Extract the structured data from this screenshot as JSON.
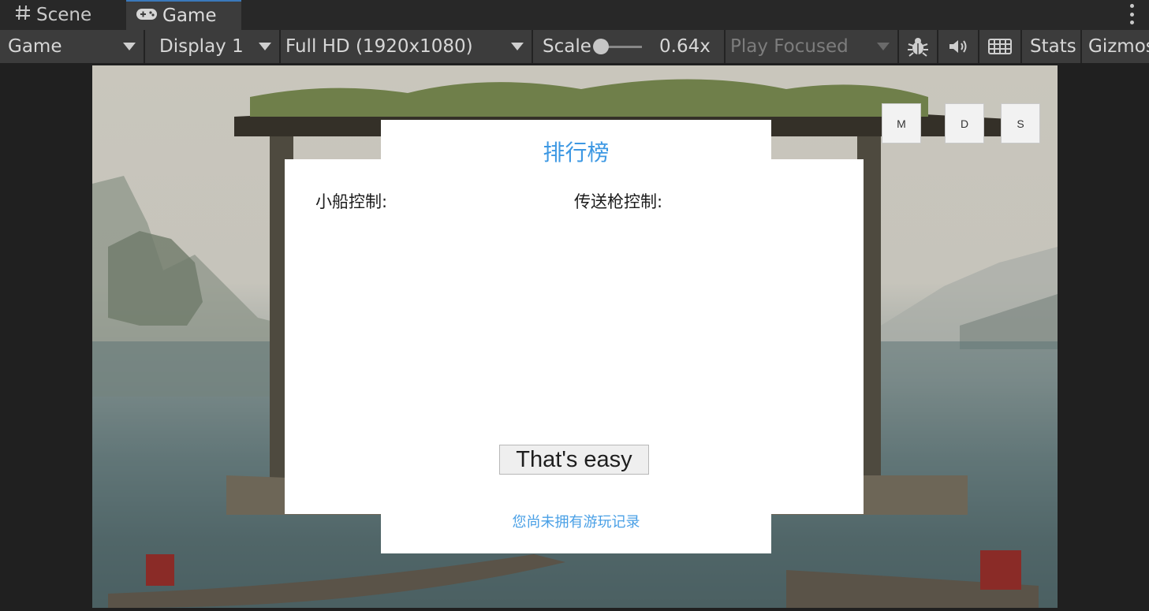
{
  "tabs": [
    {
      "label": "Scene",
      "icon": "grid-icon"
    },
    {
      "label": "Game",
      "icon": "gamepad-icon"
    }
  ],
  "toolbar": {
    "view_dropdown": "Game",
    "display_dropdown": "Display 1",
    "resolution_dropdown": "Full HD (1920x1080)",
    "scale_label": "Scale",
    "scale_value": "0.64x",
    "play_mode_dropdown": "Play Focused",
    "stats_label": "Stats",
    "gizmos_label": "Gizmos"
  },
  "game": {
    "leaderboard_title": "排行榜",
    "boat_control_label": "小船控制:",
    "teleport_gun_label": "传送枪控制:",
    "easy_button": "That's easy",
    "no_record_text": "您尚未拥有游玩记录",
    "corner_buttons": [
      "M",
      "D",
      "S"
    ]
  },
  "colors": {
    "title_blue": "#3d98e3",
    "tab_accent": "#3a79bb"
  }
}
